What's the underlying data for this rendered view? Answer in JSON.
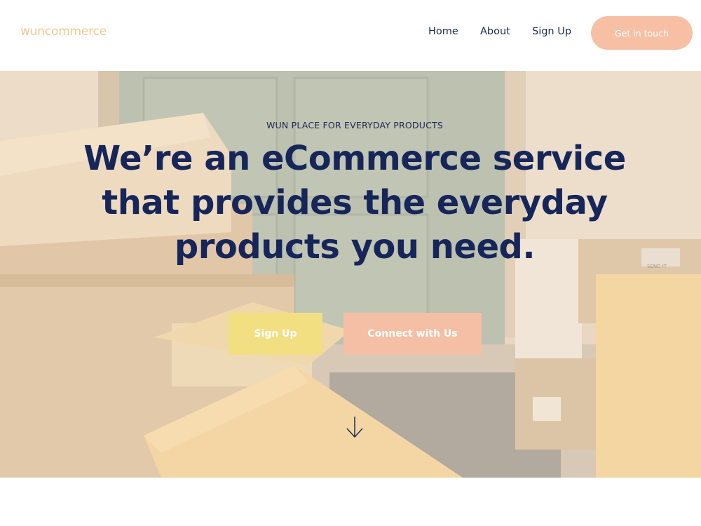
{
  "header": {
    "logo": "wuncommerce",
    "nav": [
      {
        "label": "Home"
      },
      {
        "label": "About"
      },
      {
        "label": "Sign Up"
      }
    ],
    "cta_label": "Get in touch"
  },
  "hero": {
    "eyebrow": "WUN PLACE FOR EVERYDAY PRODUCTS",
    "headline_lines": [
      "We’re an eCommerce service",
      "that provides the everyday",
      "products you need."
    ],
    "primary_button": "Sign Up",
    "secondary_button": "Connect with Us",
    "scroll_icon": "arrow-down-icon",
    "background_image": "packages-at-front-door-photo",
    "box_label_lines": [
      "SEND IT"
    ]
  },
  "colors": {
    "logo": "#f2c890",
    "nav_text": "#1a2a50",
    "headline": "#16265a",
    "cta_peach": "#f7c0a4",
    "button_yellow": "#f1df82",
    "button_peach": "#f5bfa5"
  }
}
